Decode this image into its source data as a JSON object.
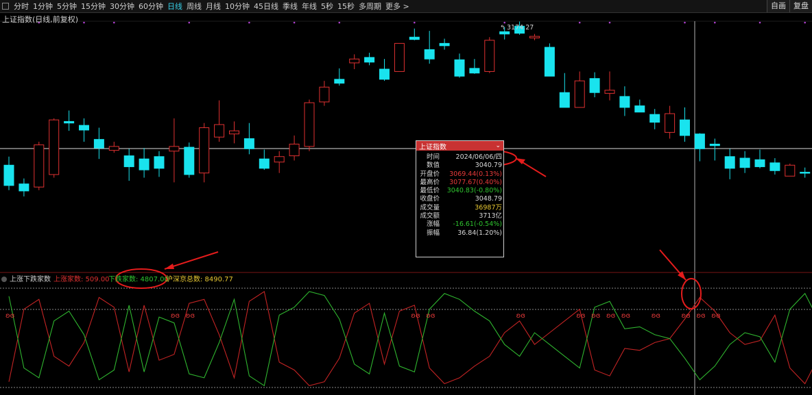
{
  "toolbar": {
    "tabs": [
      "分时",
      "1分钟",
      "5分钟",
      "15分钟",
      "30分钟",
      "60分钟",
      "日线",
      "周线",
      "月线",
      "10分钟",
      "45日线",
      "季线",
      "年线",
      "5秒",
      "15秒",
      "多周期",
      "更多 >"
    ],
    "active_tab": "日线",
    "right_buttons": [
      "自画",
      "复盘"
    ]
  },
  "chart": {
    "title": "上证指数(日线,前复权)",
    "high_label": "3174.27"
  },
  "popup": {
    "title": "上证指数",
    "rows": [
      {
        "k": "时间",
        "v": "2024/06/06/四",
        "c": "#d8d8d8"
      },
      {
        "k": "数值",
        "v": "3040.79",
        "c": "#d8d8d8"
      },
      {
        "k": "开盘价",
        "v": "3069.44(0.13%)",
        "c": "#e83a3a"
      },
      {
        "k": "最高价",
        "v": "3077.67(0.40%)",
        "c": "#e83a3a"
      },
      {
        "k": "最低价",
        "v": "3040.83(-0.80%)",
        "c": "#2fc52f"
      },
      {
        "k": "收盘价",
        "v": "3048.79",
        "c": "#d8d8d8"
      },
      {
        "k": "成交量",
        "v": "36987万",
        "c": "#e8c832"
      },
      {
        "k": "成交额",
        "v": "3713亿",
        "c": "#d8d8d8"
      },
      {
        "k": "涨幅",
        "v": "-16.61(-0.54%)",
        "c": "#2fc52f"
      },
      {
        "k": "振幅",
        "v": "36.84(1.20%)",
        "c": "#d8d8d8"
      }
    ]
  },
  "indicator": {
    "name": "上涨下跌家数",
    "up_label": "上涨家数: 509.00",
    "down_label": "下跌家数: 4807.00",
    "total_label": "沪深京总数: 8490.77"
  },
  "colors": {
    "up": "#e03131",
    "down": "#19e3ee",
    "green": "#2fc52f",
    "cyan": "#37d0e8"
  },
  "candles": [
    [
      3052,
      3063,
      3020,
      3026
    ],
    [
      3028,
      3035,
      3012,
      3019
    ],
    [
      3024,
      3082,
      3020,
      3078
    ],
    [
      3040,
      3112,
      3036,
      3110
    ],
    [
      3108,
      3122,
      3096,
      3106
    ],
    [
      3103,
      3112,
      3082,
      3097
    ],
    [
      3085,
      3100,
      3060,
      3074
    ],
    [
      3071,
      3082,
      3068,
      3076
    ],
    [
      3064,
      3073,
      3032,
      3050
    ],
    [
      3060,
      3074,
      3036,
      3046
    ],
    [
      3063,
      3070,
      3037,
      3048
    ],
    [
      3070,
      3112,
      3030,
      3076
    ],
    [
      3075,
      3081,
      3036,
      3040
    ],
    [
      3042,
      3106,
      3030,
      3100
    ],
    [
      3088,
      3135,
      3082,
      3104
    ],
    [
      3092,
      3108,
      3080,
      3096
    ],
    [
      3086,
      3106,
      3066,
      3073
    ],
    [
      3060,
      3072,
      3046,
      3048
    ],
    [
      3056,
      3070,
      3042,
      3063
    ],
    [
      3064,
      3090,
      3058,
      3079
    ],
    [
      3076,
      3136,
      3070,
      3132
    ],
    [
      3133,
      3160,
      3128,
      3152
    ],
    [
      3162,
      3176,
      3154,
      3157
    ],
    [
      3183,
      3194,
      3175,
      3188
    ],
    [
      3190,
      3196,
      3180,
      3184
    ],
    [
      3175,
      3188,
      3160,
      3162
    ],
    [
      3172,
      3205,
      3172,
      3208
    ],
    [
      3216,
      3227,
      3212,
      3213
    ],
    [
      3200,
      3224,
      3182,
      3188
    ],
    [
      3208,
      3214,
      3200,
      3205
    ],
    [
      3187,
      3195,
      3164,
      3166
    ],
    [
      3176,
      3188,
      3169,
      3170
    ],
    [
      3172,
      3216,
      3170,
      3212
    ],
    [
      3223,
      3229,
      3213,
      3220
    ],
    [
      3230,
      3236,
      3219,
      3221
    ],
    [
      3215,
      3220,
      3212,
      3217
    ],
    [
      3203,
      3208,
      3166,
      3166
    ],
    [
      3145,
      3170,
      3136,
      3126
    ],
    [
      3126,
      3172,
      3126,
      3160
    ],
    [
      3163,
      3171,
      3139,
      3145
    ],
    [
      3144,
      3172,
      3135,
      3148
    ],
    [
      3140,
      3153,
      3115,
      3126
    ],
    [
      3128,
      3136,
      3125,
      3120
    ],
    [
      3117,
      3124,
      3098,
      3107
    ],
    [
      3094,
      3128,
      3086,
      3118
    ],
    [
      3110,
      3126,
      3082,
      3090
    ],
    [
      3092,
      3093,
      3057,
      3073
    ],
    [
      3079,
      3086,
      3058,
      3077
    ],
    [
      3063,
      3073,
      3034,
      3048
    ],
    [
      3061,
      3070,
      3042,
      3049
    ],
    [
      3059,
      3072,
      3048,
      3050
    ],
    [
      3055,
      3061,
      3040,
      3045
    ],
    [
      3038,
      3054,
      3040,
      3052
    ],
    [
      3043,
      3049,
      3036,
      3042
    ],
    [
      3040,
      3052,
      3036,
      3051
    ]
  ],
  "up_series": [
    4860,
    1200,
    700,
    3600,
    4100,
    2900,
    600,
    1100,
    4400,
    1000,
    3800,
    3500,
    900,
    700,
    2500,
    4700,
    800,
    300,
    3900,
    4300,
    5100,
    4900,
    3700,
    1400,
    900,
    4000,
    1300,
    1000,
    4200,
    5000,
    4700,
    4100,
    3600,
    2400,
    1800,
    3000,
    2400,
    1800,
    1200,
    4300,
    4600,
    3200,
    3300,
    2900,
    2700,
    1700,
    600,
    1300,
    2400,
    3000,
    2800,
    1500,
    4200,
    5000,
    3500
  ],
  "down_series": [
    500,
    4200,
    4700,
    1800,
    1300,
    2500,
    4800,
    4300,
    1000,
    4400,
    1600,
    1900,
    4500,
    4700,
    2900,
    700,
    4600,
    5100,
    1500,
    1100,
    300,
    500,
    1700,
    4000,
    4500,
    1400,
    4100,
    4400,
    1200,
    400,
    700,
    1300,
    1800,
    3000,
    3600,
    2400,
    3000,
    3600,
    4200,
    1100,
    800,
    2200,
    2100,
    2500,
    2700,
    3700,
    4800,
    4100,
    3000,
    2400,
    2600,
    3900,
    1200,
    400,
    1900
  ]
}
